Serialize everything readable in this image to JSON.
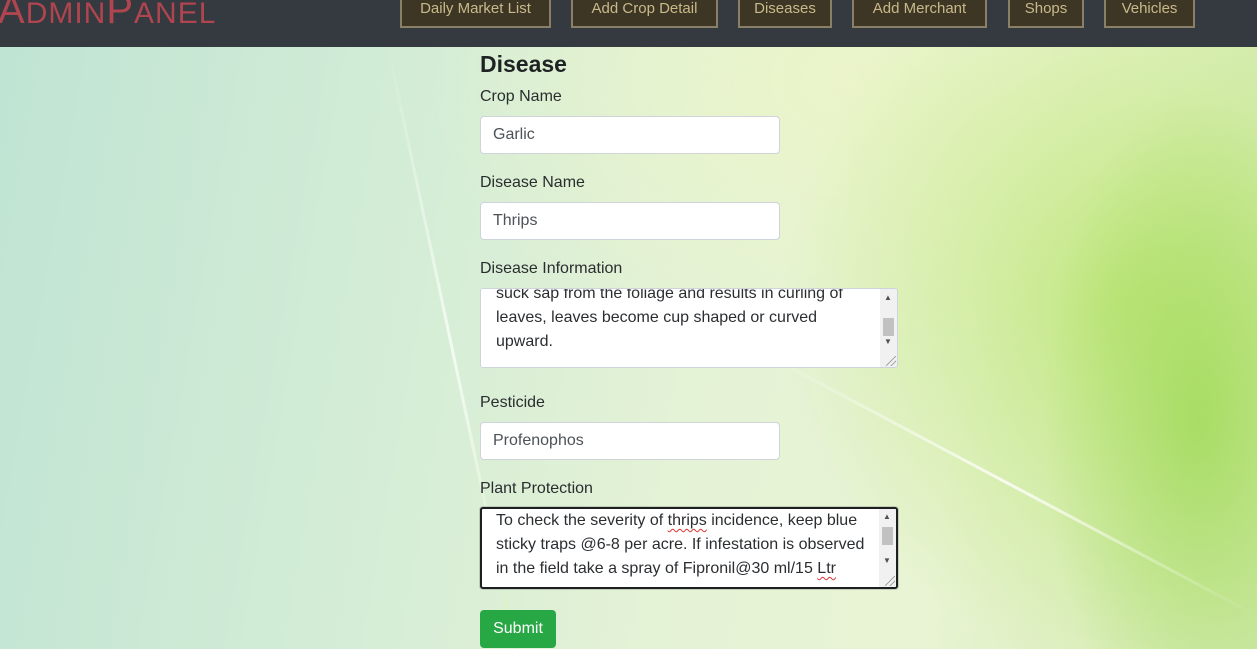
{
  "navbar": {
    "brand_first": "A",
    "brand_rest1": "DMIN",
    "brand_mid": "P",
    "brand_rest2": "ANEL",
    "links": [
      {
        "label": "Daily Market List"
      },
      {
        "label": "Add Crop Detail"
      },
      {
        "label": "Diseases"
      },
      {
        "label": "Add Merchant"
      },
      {
        "label": "Shops"
      },
      {
        "label": "Vehicles"
      }
    ]
  },
  "form": {
    "title": "Disease",
    "crop_name": {
      "label": "Crop Name",
      "value": "Garlic"
    },
    "disease_name": {
      "label": "Disease Name",
      "value": "Thrips"
    },
    "disease_info": {
      "label": "Disease Information",
      "lines": [
        "suck sap from the foliage and results in curling of",
        "leaves, leaves become cup shaped or curved",
        "upward."
      ]
    },
    "pesticide": {
      "label": "Pesticide",
      "value": "Profenophos"
    },
    "plant_protection": {
      "label": "Plant Protection",
      "line1_a": "To check the severity of ",
      "line1_b": "thrips",
      "line1_c": " incidence, keep blue",
      "line2": "sticky traps @6-8 per acre. If infestation is observed",
      "line3_a": "in the field take a spray of Fipronil@30 ml/15 ",
      "line3_b": "Ltr"
    },
    "submit_label": "Submit"
  }
}
